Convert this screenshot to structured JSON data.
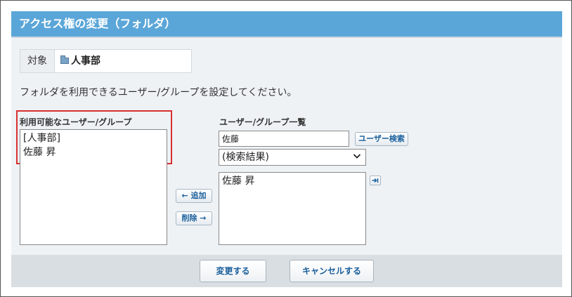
{
  "title": "アクセス権の変更（フォルダ）",
  "target": {
    "label": "対象",
    "value": "人事部",
    "icon": "folder-icon"
  },
  "instruction": "フォルダを利用できるユーザー/グループを設定してください。",
  "available": {
    "label": "利用可能なユーザー/グループ",
    "items": [
      "[人事部]",
      "佐藤 昇"
    ]
  },
  "userlist": {
    "label": "ユーザー/グループ一覧",
    "search_value": "佐藤",
    "search_button": "ユーザー検索",
    "select_value": "(検索結果)",
    "items": [
      "佐藤 昇"
    ]
  },
  "buttons": {
    "add": "← 追加",
    "remove": "削除 →",
    "submit": "変更する",
    "cancel": "キャンセルする"
  },
  "colors": {
    "titlebar": "#5ba6d8",
    "highlight": "#d93030",
    "link": "#1a5f9c"
  }
}
